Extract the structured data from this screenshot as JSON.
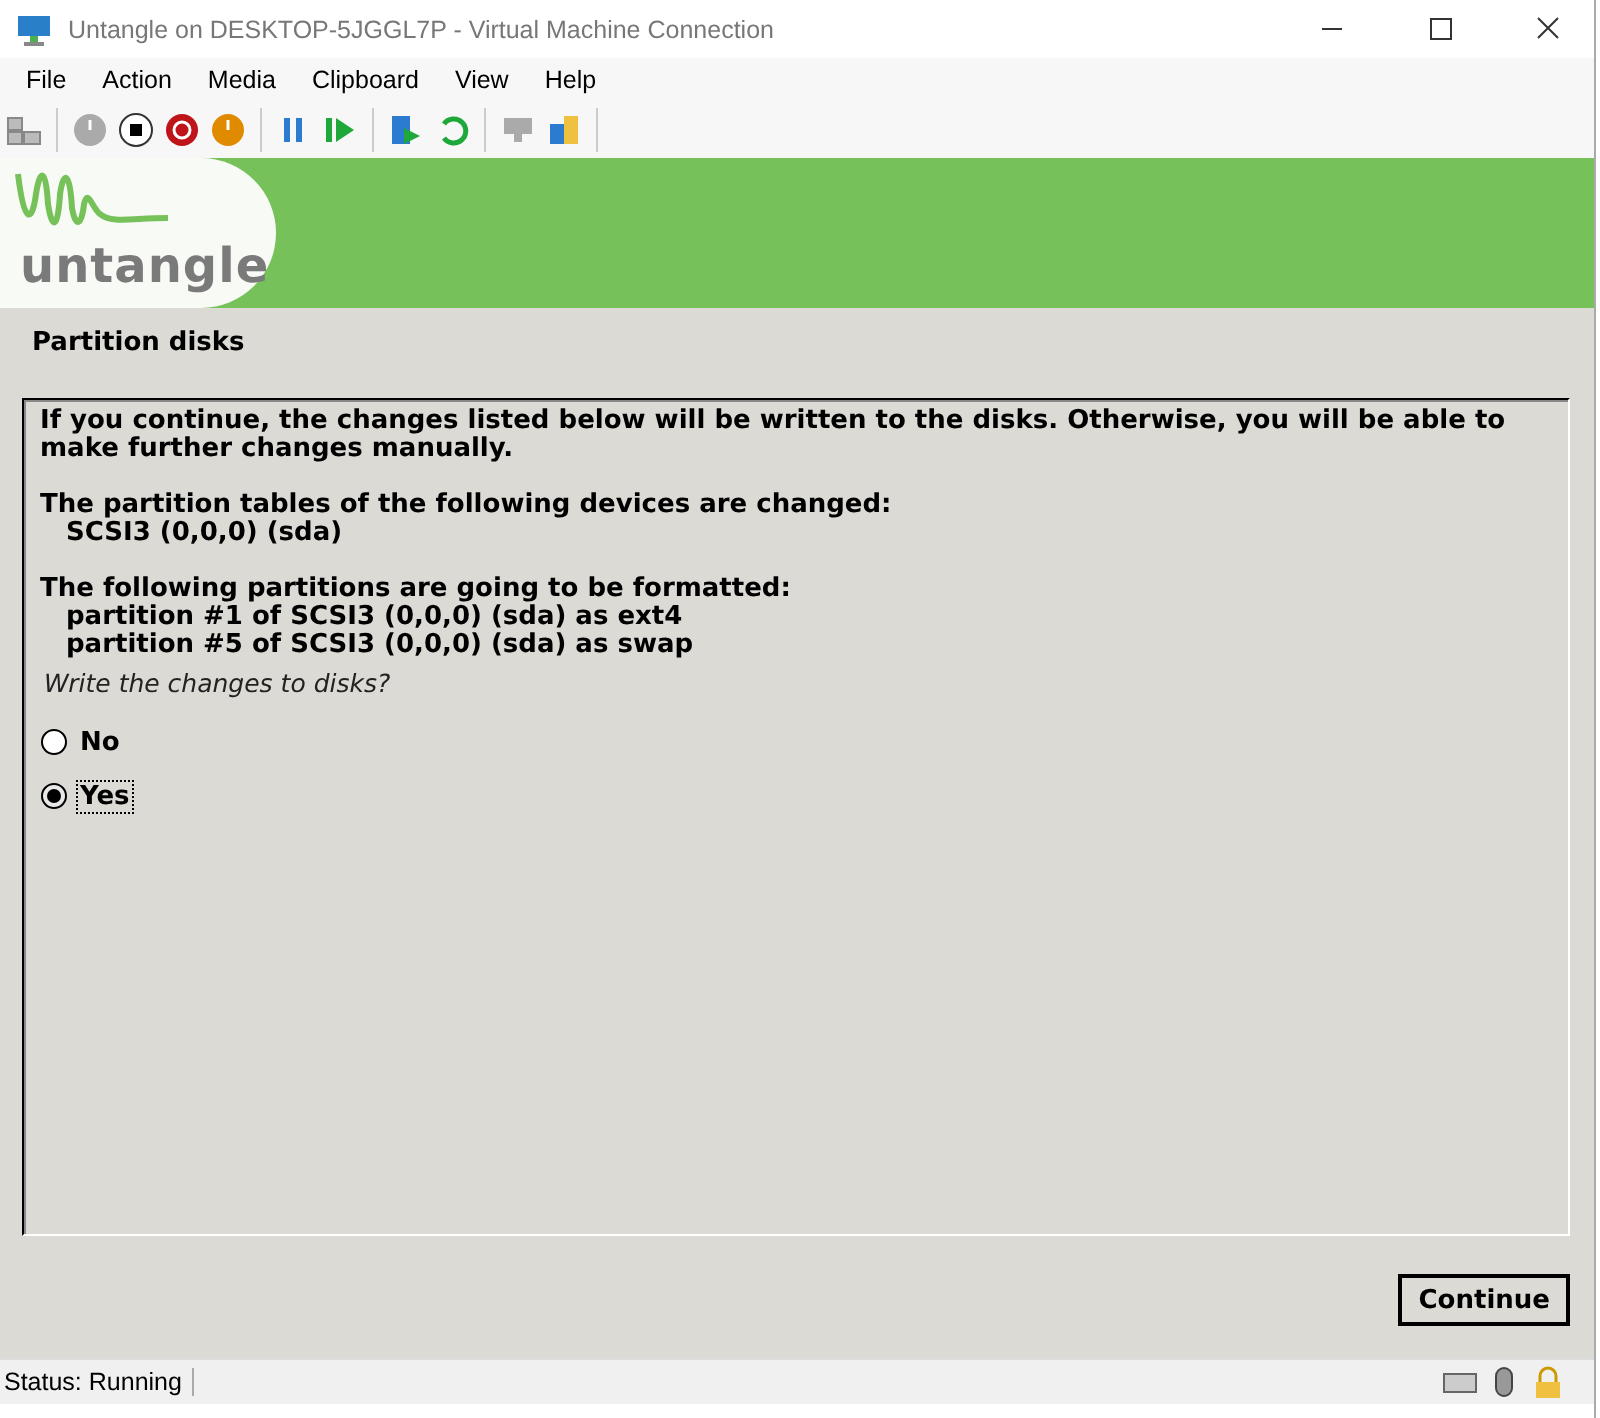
{
  "window": {
    "title": "Untangle on DESKTOP-5JGGL7P - Virtual Machine Connection"
  },
  "menu": [
    "File",
    "Action",
    "Media",
    "Clipboard",
    "View",
    "Help"
  ],
  "installer": {
    "logo_text": "untangle",
    "step_title": "Partition disks",
    "paragraphs": [
      {
        "heading": "If you continue, the changes listed below will be written to the disks. Otherwise, you will be able to make further changes manually."
      },
      {
        "heading": "The partition tables of the following devices are changed:",
        "items": [
          "SCSI3 (0,0,0) (sda)"
        ]
      },
      {
        "heading": "The following partitions are going to be formatted:",
        "items": [
          "partition #1 of SCSI3 (0,0,0) (sda) as ext4",
          "partition #5 of SCSI3 (0,0,0) (sda) as swap"
        ]
      }
    ],
    "question": "Write the changes to disks?",
    "options": [
      {
        "label": "No",
        "selected": false
      },
      {
        "label": "Yes",
        "selected": true
      }
    ],
    "continue_button": "Continue"
  },
  "status_bar": {
    "status": "Status: Running"
  }
}
